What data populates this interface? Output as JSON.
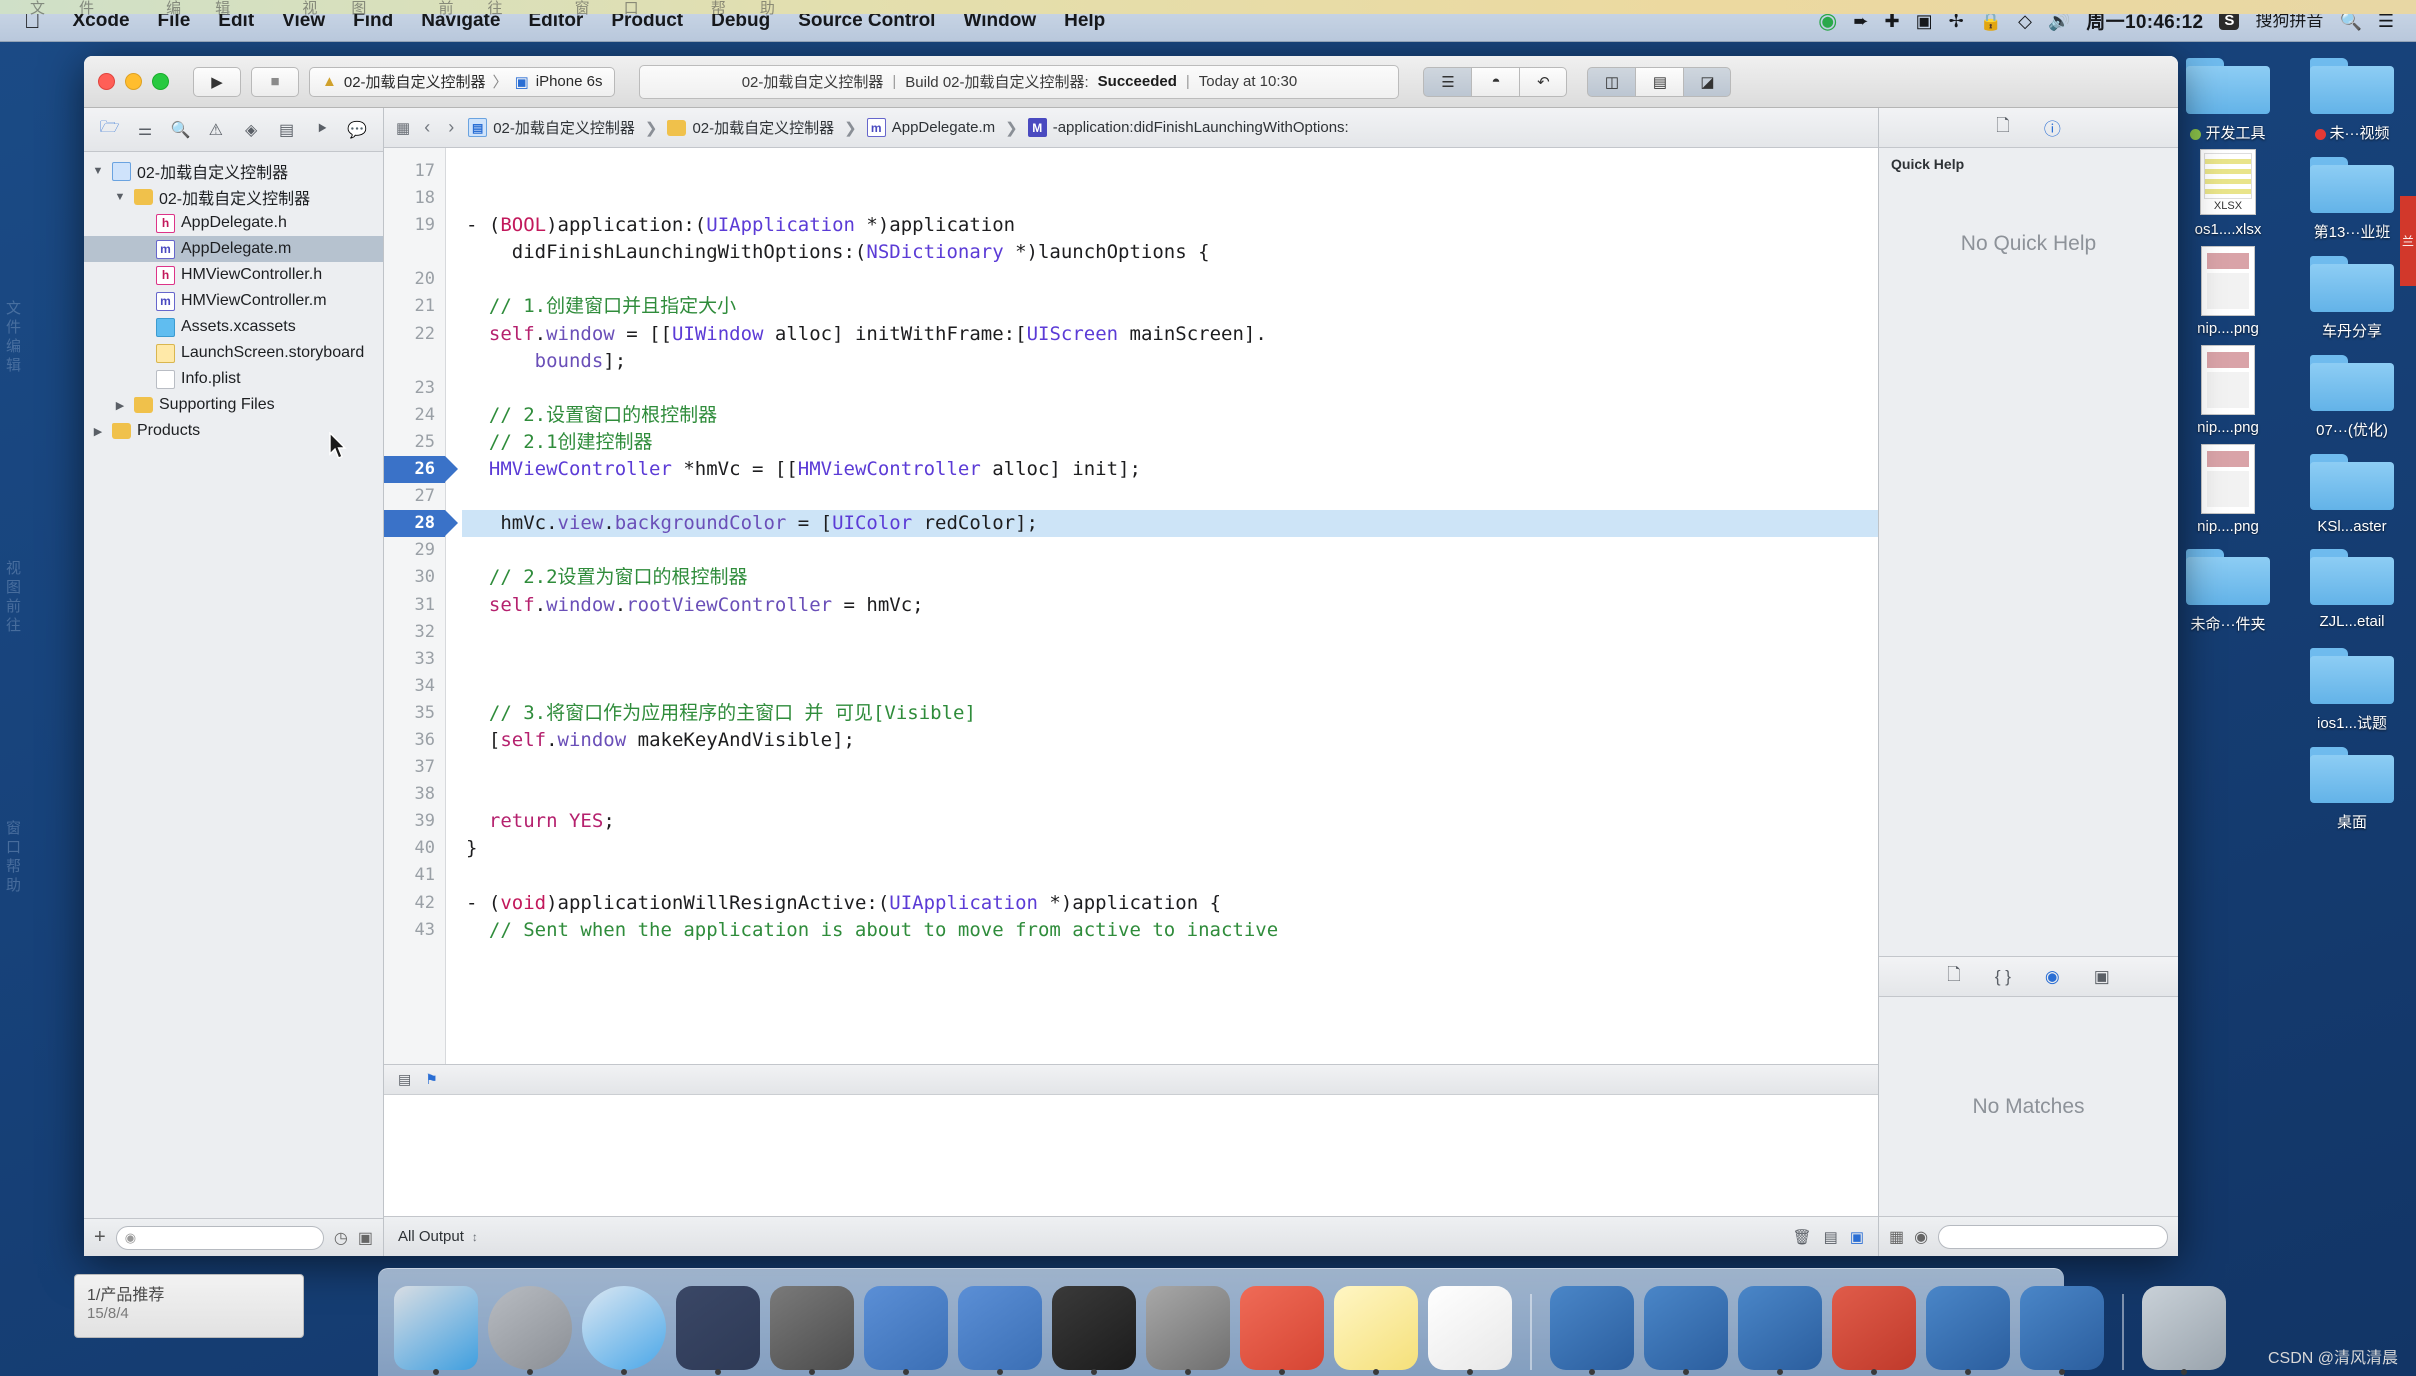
{
  "menubar": {
    "apple_icon": "apple-icon",
    "items": [
      "Xcode",
      "File",
      "Edit",
      "View",
      "Find",
      "Navigate",
      "Editor",
      "Product",
      "Debug",
      "Source Control",
      "Window",
      "Help"
    ],
    "status_icons": [
      "play-circle-icon",
      "location-arrow-icon",
      "airdrop-icon",
      "screen-record-icon",
      "bluetooth-icon",
      "lock-icon",
      "wifi-icon",
      "volume-icon"
    ],
    "clock": "周一10:46:12",
    "input_method": "搜狗拼音",
    "input_method_badge": "S",
    "search_icon": "search-icon",
    "control_center_icon": "list-icon"
  },
  "toolbar": {
    "traffic_lights": [
      "close-button",
      "minimize-button",
      "maximize-button"
    ],
    "run_icon": "play-icon",
    "stop_icon": "stop-icon",
    "scheme_app_icon": "xcode-scheme-icon",
    "scheme_name": "02-加载自定义控制器",
    "scheme_separator": "〉",
    "device_icon": "iphone-icon",
    "device_name": "iPhone 6s",
    "status": {
      "project": "02-加载自定义控制器",
      "divider": "|",
      "build_text": "Build 02-加载自定义控制器:",
      "result": "Succeeded",
      "divider2": "|",
      "time": "Today at 10:30"
    },
    "right_buttons": [
      "editor-standard-icon",
      "editor-assistant-icon",
      "editor-version-icon"
    ],
    "view_buttons": [
      "toggle-navigator-icon",
      "toggle-debug-icon",
      "toggle-utilities-icon"
    ]
  },
  "navigator": {
    "tabs": [
      {
        "name": "project-navigator-tab",
        "icon": "folder-icon",
        "selected": true
      },
      {
        "name": "source-control-navigator-tab",
        "icon": "branch-icon",
        "selected": false
      },
      {
        "name": "symbol-navigator-tab",
        "icon": "search-icon",
        "selected": false
      },
      {
        "name": "issue-navigator-tab",
        "icon": "warning-icon",
        "selected": false
      },
      {
        "name": "test-navigator-tab",
        "icon": "diamond-icon",
        "selected": false
      },
      {
        "name": "debug-navigator-tab",
        "icon": "debug-icon",
        "selected": false
      },
      {
        "name": "breakpoint-navigator-tab",
        "icon": "tag-icon",
        "selected": false
      },
      {
        "name": "report-navigator-tab",
        "icon": "message-icon",
        "selected": false
      }
    ],
    "tree": [
      {
        "label": "02-加载自定义控制器",
        "indent": 0,
        "twisty": "▼",
        "icon": "proj",
        "selected": false
      },
      {
        "label": "02-加载自定义控制器",
        "indent": 1,
        "twisty": "▼",
        "icon": "folder",
        "selected": false
      },
      {
        "label": "AppDelegate.h",
        "indent": 2,
        "twisty": "",
        "icon": "h",
        "selected": false
      },
      {
        "label": "AppDelegate.m",
        "indent": 2,
        "twisty": "",
        "icon": "m",
        "selected": true
      },
      {
        "label": "HMViewController.h",
        "indent": 2,
        "twisty": "",
        "icon": "h",
        "selected": false
      },
      {
        "label": "HMViewController.m",
        "indent": 2,
        "twisty": "",
        "icon": "m",
        "selected": false
      },
      {
        "label": "Assets.xcassets",
        "indent": 2,
        "twisty": "",
        "icon": "assets",
        "selected": false
      },
      {
        "label": "LaunchScreen.storyboard",
        "indent": 2,
        "twisty": "",
        "icon": "sb",
        "selected": false
      },
      {
        "label": "Info.plist",
        "indent": 2,
        "twisty": "",
        "icon": "plist",
        "selected": false
      },
      {
        "label": "Supporting Files",
        "indent": 1,
        "twisty": "▶",
        "icon": "folder",
        "selected": false
      },
      {
        "label": "Products",
        "indent": 0,
        "twisty": "▶",
        "icon": "folder",
        "selected": false
      }
    ],
    "bottom": {
      "add_icon": "plus-icon",
      "filter_placeholder": "",
      "recent_icon": "clock-icon",
      "source_control_icon": "source-control-filter-icon"
    }
  },
  "jumpbar": {
    "related_icon": "related-files-icon",
    "back_icon": "chevron-left-icon",
    "forward_icon": "chevron-right-icon",
    "crumbs": [
      {
        "icon": "proj",
        "label": "02-加载自定义控制器"
      },
      {
        "icon": "folder",
        "label": "02-加载自定义控制器"
      },
      {
        "icon": "m",
        "label": "AppDelegate.m"
      },
      {
        "icon": "method",
        "label": "-application:didFinishLaunchingWithOptions:"
      }
    ]
  },
  "code": {
    "first_line_number": 17,
    "selected_line": 28,
    "marked_lines": [
      26,
      28
    ],
    "lines": [
      {
        "n": 17,
        "tokens": []
      },
      {
        "n": 18,
        "tokens": []
      },
      {
        "n": 19,
        "tokens": [
          {
            "t": "- (",
            "c": "plain"
          },
          {
            "t": "BOOL",
            "c": "pink"
          },
          {
            "t": ")application:(",
            "c": "plain"
          },
          {
            "t": "UIApplication",
            "c": "type"
          },
          {
            "t": " *)application",
            "c": "plain"
          }
        ]
      },
      {
        "n": "",
        "cont": true,
        "tokens": [
          {
            "t": "    didFinishLaunchingWithOptions:(",
            "c": "plain"
          },
          {
            "t": "NSDictionary",
            "c": "type"
          },
          {
            "t": " *)launchOptions {",
            "c": "plain"
          }
        ]
      },
      {
        "n": 20,
        "tokens": []
      },
      {
        "n": 21,
        "tokens": [
          {
            "t": "  // 1.创建窗口并且指定大小",
            "c": "cmt"
          }
        ]
      },
      {
        "n": 22,
        "tokens": [
          {
            "t": "  ",
            "c": "plain"
          },
          {
            "t": "self",
            "c": "kw"
          },
          {
            "t": ".",
            "c": "plain"
          },
          {
            "t": "window",
            "c": "prop"
          },
          {
            "t": " = [[",
            "c": "plain"
          },
          {
            "t": "UIWindow",
            "c": "type"
          },
          {
            "t": " alloc] initWithFrame:[",
            "c": "plain"
          },
          {
            "t": "UIScreen",
            "c": "type"
          },
          {
            "t": " mainScreen].",
            "c": "plain"
          }
        ]
      },
      {
        "n": "",
        "cont": true,
        "tokens": [
          {
            "t": "      ",
            "c": "plain"
          },
          {
            "t": "bounds",
            "c": "prop"
          },
          {
            "t": "];",
            "c": "plain"
          }
        ]
      },
      {
        "n": 23,
        "tokens": []
      },
      {
        "n": 24,
        "tokens": [
          {
            "t": "  // 2.设置窗口的根控制器",
            "c": "cmt"
          }
        ]
      },
      {
        "n": 25,
        "tokens": [
          {
            "t": "  // 2.1创建控制器",
            "c": "cmt"
          }
        ]
      },
      {
        "n": 26,
        "tokens": [
          {
            "t": "  ",
            "c": "plain"
          },
          {
            "t": "HMViewController",
            "c": "type"
          },
          {
            "t": " *hmVc = [[",
            "c": "plain"
          },
          {
            "t": "HMViewController",
            "c": "type"
          },
          {
            "t": " alloc] init];",
            "c": "plain"
          }
        ]
      },
      {
        "n": 27,
        "tokens": []
      },
      {
        "n": 28,
        "hl": true,
        "tokens": [
          {
            "t": "   hmVc.",
            "c": "plain"
          },
          {
            "t": "view",
            "c": "prop"
          },
          {
            "t": ".",
            "c": "plain"
          },
          {
            "t": "backgroundColor",
            "c": "prop"
          },
          {
            "t": " = [",
            "c": "plain"
          },
          {
            "t": "UIColor",
            "c": "type"
          },
          {
            "t": " redColor];",
            "c": "plain"
          }
        ]
      },
      {
        "n": 29,
        "tokens": []
      },
      {
        "n": 30,
        "tokens": [
          {
            "t": "  // 2.2设置为窗口的根控制器",
            "c": "cmt"
          }
        ]
      },
      {
        "n": 31,
        "tokens": [
          {
            "t": "  ",
            "c": "plain"
          },
          {
            "t": "self",
            "c": "kw"
          },
          {
            "t": ".",
            "c": "plain"
          },
          {
            "t": "window",
            "c": "prop"
          },
          {
            "t": ".",
            "c": "plain"
          },
          {
            "t": "rootViewController",
            "c": "prop"
          },
          {
            "t": " = hmVc;",
            "c": "plain"
          }
        ]
      },
      {
        "n": 32,
        "tokens": []
      },
      {
        "n": 33,
        "tokens": []
      },
      {
        "n": 34,
        "tokens": []
      },
      {
        "n": 35,
        "tokens": [
          {
            "t": "  // 3.将窗口作为应用程序的主窗口 并 可见[Visible]",
            "c": "cmt"
          }
        ]
      },
      {
        "n": 36,
        "tokens": [
          {
            "t": "  [",
            "c": "plain"
          },
          {
            "t": "self",
            "c": "kw"
          },
          {
            "t": ".",
            "c": "plain"
          },
          {
            "t": "window",
            "c": "prop"
          },
          {
            "t": " makeKeyAndVisible];",
            "c": "plain"
          }
        ]
      },
      {
        "n": 37,
        "tokens": []
      },
      {
        "n": 38,
        "tokens": []
      },
      {
        "n": 39,
        "tokens": [
          {
            "t": "  ",
            "c": "plain"
          },
          {
            "t": "return",
            "c": "kw"
          },
          {
            "t": " ",
            "c": "plain"
          },
          {
            "t": "YES",
            "c": "kw"
          },
          {
            "t": ";",
            "c": "plain"
          }
        ]
      },
      {
        "n": 40,
        "tokens": [
          {
            "t": "}",
            "c": "plain"
          }
        ]
      },
      {
        "n": 41,
        "tokens": []
      },
      {
        "n": 42,
        "tokens": [
          {
            "t": "- (",
            "c": "plain"
          },
          {
            "t": "void",
            "c": "pink"
          },
          {
            "t": ")applicationWillResignActive:(",
            "c": "plain"
          },
          {
            "t": "UIApplication",
            "c": "type"
          },
          {
            "t": " *)application {",
            "c": "plain"
          }
        ]
      },
      {
        "n": 43,
        "tokens": [
          {
            "t": "  // Sent when the application is about to move from active to inactive",
            "c": "cmt"
          }
        ]
      }
    ]
  },
  "debug": {
    "toolbar_icons": [
      "filter-bar-icon",
      "flag-icon"
    ],
    "filter_label": "All Output",
    "filter_chevron": "⌄",
    "trash_icon": "trash-icon",
    "split_icons": [
      "console-only-icon",
      "variables-only-icon"
    ]
  },
  "bottombar": {
    "left_label": "All Output",
    "chevron": "⌃⌄"
  },
  "utilities": {
    "tabs_top": [
      {
        "name": "file-inspector-tab",
        "icon": "document-icon",
        "selected": false
      },
      {
        "name": "quick-help-inspector-tab",
        "icon": "help-icon",
        "selected": true
      }
    ],
    "quick_help_title": "Quick Help",
    "quick_help_body": "No Quick Help",
    "library_tabs": [
      {
        "name": "file-template-library-tab",
        "icon": "document-icon",
        "selected": false
      },
      {
        "name": "code-snippet-library-tab",
        "icon": "braces-icon",
        "selected": false
      },
      {
        "name": "object-library-tab",
        "icon": "circle-icon",
        "selected": true
      },
      {
        "name": "media-library-tab",
        "icon": "media-icon",
        "selected": false
      }
    ],
    "library_body": "No Matches",
    "library_filter_placeholder": "",
    "library_grid_icon": "grid-icon",
    "library_search_icon": "search-icon"
  },
  "desktop": {
    "side_glyphs": [
      "文件",
      "编辑",
      "视图",
      "前往",
      "窗口",
      "帮助"
    ],
    "icons": [
      {
        "label": "开发工具",
        "type": "folder",
        "tag": "#8bc34a"
      },
      {
        "label": "未···视频",
        "type": "folder",
        "tag": "#e53935"
      },
      {
        "label": "os1....xlsx",
        "type": "xlsx",
        "badge": "XLSX"
      },
      {
        "label": "第13···业班",
        "type": "folder"
      },
      {
        "label": "nip....png",
        "type": "png"
      },
      {
        "label": "车丹分享",
        "type": "folder"
      },
      {
        "label": "nip....png",
        "type": "png"
      },
      {
        "label": "07···(优化)",
        "type": "folder"
      },
      {
        "label": "nip....png",
        "type": "png"
      },
      {
        "label": "KSl...aster",
        "type": "folder"
      },
      {
        "label": "未命···件夹",
        "type": "folder"
      },
      {
        "label": "ZJL...etail",
        "type": "folder"
      },
      {
        "label": "",
        "type": "none"
      },
      {
        "label": "ios1...试题",
        "type": "folder"
      },
      {
        "label": "",
        "type": "none"
      },
      {
        "label": "桌面",
        "type": "folder"
      }
    ],
    "red_tab_label": "兰"
  },
  "infocard": {
    "title": "1/产品推荐",
    "subtitle": "15/8/4"
  },
  "dock": {
    "apps": [
      {
        "name": "finder",
        "color1": "#3f9fe0",
        "color2": "#d8dde3"
      },
      {
        "name": "launchpad",
        "color1": "#8b8f95",
        "color2": "#b8bcc2"
      },
      {
        "name": "safari",
        "color1": "#4aa7e8",
        "color2": "#dbe7f2"
      },
      {
        "name": "mouse-app",
        "color1": "#2e3a56",
        "color2": "#3a4766"
      },
      {
        "name": "imovie",
        "color1": "#4c4c4c",
        "color2": "#7a7a7a"
      },
      {
        "name": "xcode-beta",
        "color1": "#3b6fb5",
        "color2": "#5b8fd6"
      },
      {
        "name": "xcode",
        "color1": "#3b6fb5",
        "color2": "#5b8fd6"
      },
      {
        "name": "terminal",
        "color1": "#1c1c1c",
        "color2": "#3a3a3a"
      },
      {
        "name": "system-preferences",
        "color1": "#6f6f6f",
        "color2": "#a8a8a8"
      },
      {
        "name": "xmind",
        "color1": "#d64533",
        "color2": "#ef6b57"
      },
      {
        "name": "notes",
        "color1": "#f5e07a",
        "color2": "#fff6c4"
      },
      {
        "name": "executable",
        "color1": "#e8e8e8",
        "color2": "#ffffff"
      },
      {
        "name": "display-1",
        "color1": "#2b5e9e",
        "color2": "#4a86c8"
      },
      {
        "name": "display-2",
        "color1": "#2b5e9e",
        "color2": "#4a86c8"
      },
      {
        "name": "display-3",
        "color1": "#2b5e9e",
        "color2": "#4a86c8"
      },
      {
        "name": "display-4",
        "color1": "#c03a2b",
        "color2": "#e05c4a"
      },
      {
        "name": "display-5",
        "color1": "#2b5e9e",
        "color2": "#4a86c8"
      },
      {
        "name": "display-6",
        "color1": "#2b5e9e",
        "color2": "#4a86c8"
      },
      {
        "name": "trash",
        "color1": "#9aa4ad",
        "color2": "#c9d1d8"
      }
    ]
  },
  "watermark": "CSDN @清风清晨"
}
